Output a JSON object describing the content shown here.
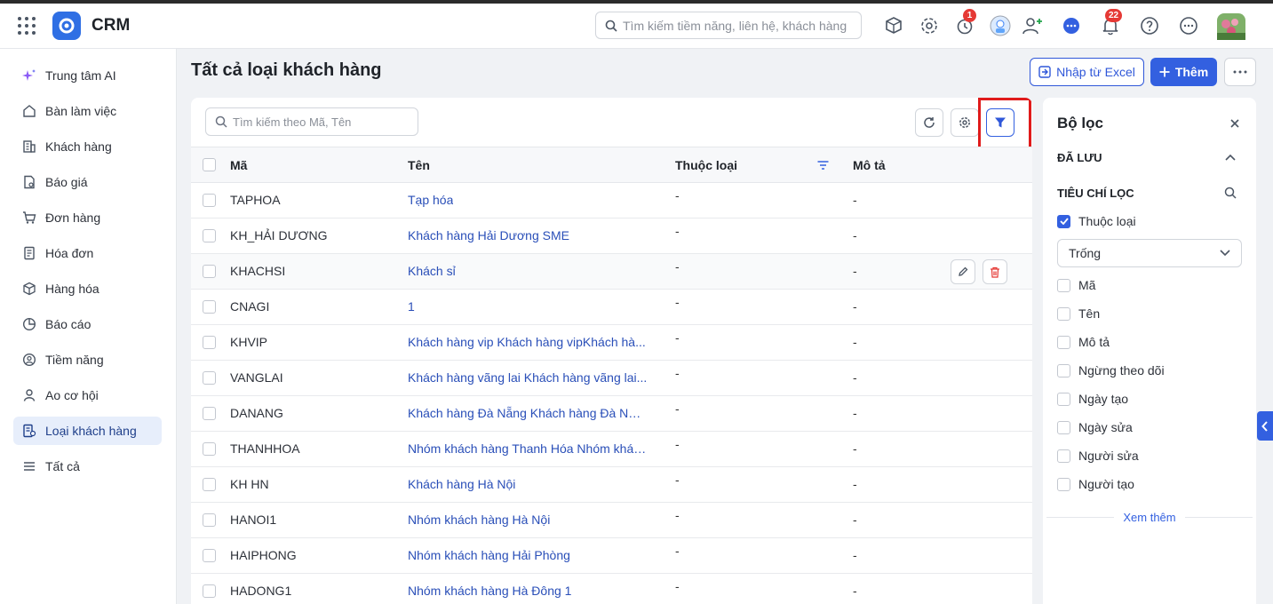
{
  "app": {
    "name": "CRM"
  },
  "top_search": {
    "placeholder": "Tìm kiếm tiềm năng, liên hệ, khách hàng"
  },
  "notifications": {
    "clock_badge": "1",
    "bell_badge": "22"
  },
  "sidebar": {
    "items": [
      {
        "label": "Trung tâm AI",
        "icon": "sparkle-icon"
      },
      {
        "label": "Bàn làm việc",
        "icon": "home-icon"
      },
      {
        "label": "Khách hàng",
        "icon": "building-icon"
      },
      {
        "label": "Báo giá",
        "icon": "quote-document-icon"
      },
      {
        "label": "Đơn hàng",
        "icon": "cart-icon"
      },
      {
        "label": "Hóa đơn",
        "icon": "invoice-icon"
      },
      {
        "label": "Hàng hóa",
        "icon": "box-icon"
      },
      {
        "label": "Báo cáo",
        "icon": "pie-chart-icon"
      },
      {
        "label": "Tiềm năng",
        "icon": "target-icon"
      },
      {
        "label": "Ao cơ hội",
        "icon": "opportunity-icon"
      },
      {
        "label": "Loại khách hàng",
        "icon": "customer-type-icon",
        "active": true
      },
      {
        "label": "Tất cả",
        "icon": "list-icon"
      }
    ]
  },
  "page": {
    "title": "Tất cả loại khách hàng",
    "import_label": "Nhập từ Excel",
    "add_label": "Thêm"
  },
  "list": {
    "search_placeholder": "Tìm kiếm theo Mã, Tên",
    "columns": {
      "code": "Mã",
      "name": "Tên",
      "type": "Thuộc loại",
      "desc": "Mô tả"
    },
    "rows": [
      {
        "code": "TAPHOA",
        "name": "Tạp hóa",
        "type": "-",
        "desc": "-"
      },
      {
        "code": "KH_HẢI DƯƠNG",
        "name": "Khách hàng Hải Dương SME",
        "type": "-",
        "desc": "-"
      },
      {
        "code": "KHACHSI",
        "name": "Khách sỉ",
        "type": "-",
        "desc": "-"
      },
      {
        "code": "CNAGI",
        "name": "1",
        "type": "-",
        "desc": "-"
      },
      {
        "code": "KHVIP",
        "name": "Khách hàng vip Khách hàng vipKhách hà...",
        "type": "-",
        "desc": "-"
      },
      {
        "code": "VANGLAI",
        "name": "Khách hàng vãng lai Khách hàng vãng lai...",
        "type": "-",
        "desc": "-"
      },
      {
        "code": "DANANG",
        "name": "Khách hàng Đà Nẵng Khách hàng Đà Nẵn...",
        "type": "-",
        "desc": "-"
      },
      {
        "code": "THANHHOA",
        "name": "Nhóm khách hàng Thanh Hóa Nhóm khác...",
        "type": "-",
        "desc": "-"
      },
      {
        "code": "KH HN",
        "name": "Khách hàng Hà Nội",
        "type": "-",
        "desc": "-"
      },
      {
        "code": "HANOI1",
        "name": "Nhóm khách hàng Hà Nội",
        "type": "-",
        "desc": "-"
      },
      {
        "code": "HAIPHONG",
        "name": "Nhóm khách hàng Hải Phòng",
        "type": "-",
        "desc": "-"
      },
      {
        "code": "HADONG1",
        "name": "Nhóm khách hàng Hà Đông 1",
        "type": "-",
        "desc": "-"
      }
    ]
  },
  "filter": {
    "title": "Bộ lọc",
    "saved_label": "ĐÃ LƯU",
    "criteria_label": "TIÊU CHÍ LỌC",
    "checked_option": "Thuộc loại",
    "select_value": "Trống",
    "options": [
      "Mã",
      "Tên",
      "Mô tả",
      "Ngừng theo dõi",
      "Ngày tạo",
      "Ngày sửa",
      "Người sửa",
      "Người tạo"
    ],
    "more_label": "Xem thêm"
  },
  "colors": {
    "accent": "#3360e0",
    "link": "#2a4fb8",
    "highlight": "#e01b1b"
  }
}
